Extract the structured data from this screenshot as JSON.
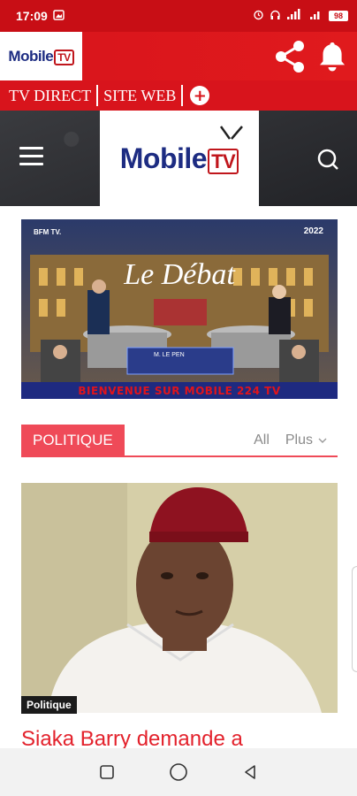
{
  "status": {
    "time": "17:09",
    "battery": "98"
  },
  "brand": {
    "logo_main": "Mobile",
    "logo_tv": "TV"
  },
  "tabs": [
    {
      "label": "TV DIRECT"
    },
    {
      "label": "SITE WEB"
    }
  ],
  "banner": {
    "channel": "BFM TV.",
    "title": "Le Débat",
    "year": "2022",
    "nameplate": "M. LE PEN",
    "caption": "BIENVENUE SUR MOBILE 224  TV"
  },
  "section": {
    "tag": "POLITIQUE",
    "filter_all": "All",
    "filter_more": "Plus"
  },
  "article": {
    "category": "Politique",
    "title": "Siaka Barry demande a"
  },
  "colors": {
    "brand_red": "#d8141c",
    "accent_pink": "#ef4a58",
    "logo_blue": "#1d2c82"
  }
}
